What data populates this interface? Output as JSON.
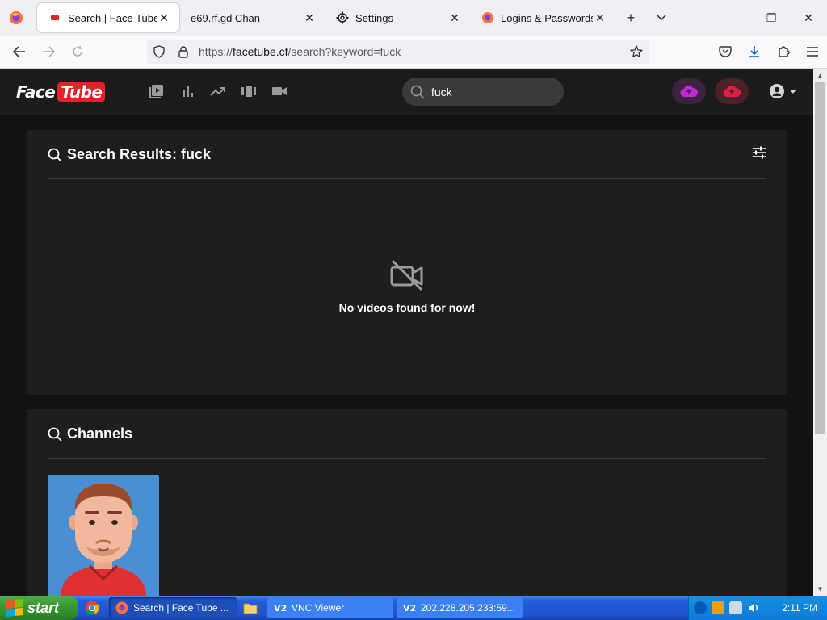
{
  "browser": {
    "tabs": [
      {
        "title": "Search | Face Tube",
        "active": true
      },
      {
        "title": "e69.rf.gd Chan",
        "active": false
      },
      {
        "title": "Settings",
        "active": false
      },
      {
        "title": "Logins & Passwords",
        "active": false
      }
    ],
    "url_prefix": "https://",
    "url_domain": "facetube.cf",
    "url_path": "/search?keyword=fuck"
  },
  "site": {
    "logo_part1": "Face",
    "logo_part2": "Tube",
    "search_value": "fuck",
    "results_title": "Search Results: fuck",
    "empty_message": "No videos found for now!",
    "channels_title": "Channels"
  },
  "taskbar": {
    "start_label": "start",
    "tasks": [
      {
        "label": "Search | Face Tube ..."
      },
      {
        "label": "VNC Viewer"
      },
      {
        "label": "202.228.205.233:59..."
      }
    ],
    "clock": "2:11 PM"
  },
  "colors": {
    "brand_red": "#e8202a",
    "header_bg": "#1c1c1c",
    "card_bg": "#1e1e1e",
    "page_bg": "#121212"
  }
}
